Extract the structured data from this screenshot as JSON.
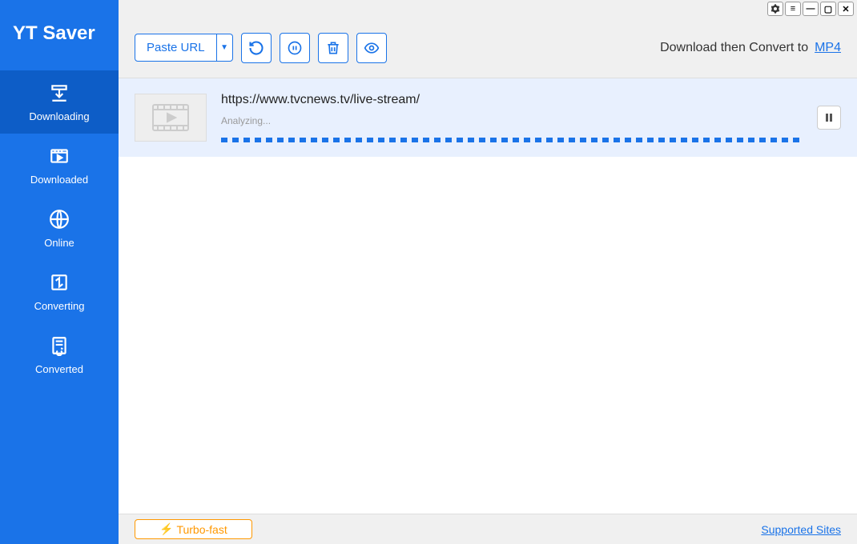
{
  "app": {
    "title": "YT Saver"
  },
  "sidebar": {
    "items": [
      {
        "label": "Downloading"
      },
      {
        "label": "Downloaded"
      },
      {
        "label": "Online"
      },
      {
        "label": "Converting"
      },
      {
        "label": "Converted"
      }
    ]
  },
  "toolbar": {
    "paste_url_label": "Paste URL",
    "convert_prefix": "Download then Convert to",
    "convert_format": "MP4"
  },
  "downloads": [
    {
      "url": "https://www.tvcnews.tv/live-stream/",
      "status": "Analyzing..."
    }
  ],
  "footer": {
    "turbo_label": "Turbo-fast",
    "supported_label": "Supported Sites"
  }
}
